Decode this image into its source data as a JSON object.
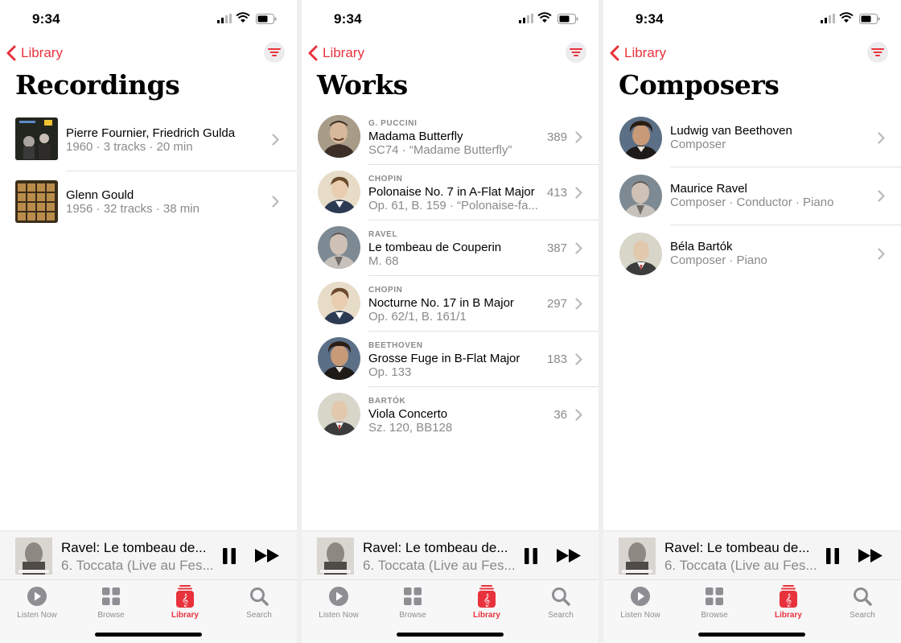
{
  "status": {
    "time": "9:34"
  },
  "nav": {
    "back_label": "Library"
  },
  "screens": {
    "recordings": {
      "title": "Recordings",
      "items": [
        {
          "title": "Pierre Fournier, Friedrich Gulda",
          "subtitle": "1960 · 3 tracks · 20 min"
        },
        {
          "title": "Glenn Gould",
          "subtitle": "1956 · 32 tracks · 38 min"
        }
      ]
    },
    "works": {
      "title": "Works",
      "items": [
        {
          "composer": "G. PUCCINI",
          "title": "Madama Butterfly",
          "subtitle": "SC74 · “Madame Butterfly”",
          "count": "389"
        },
        {
          "composer": "CHOPIN",
          "title": "Polonaise No. 7 in A-Flat Major",
          "subtitle": "Op. 61, B. 159 · “Polonaise-fa...",
          "count": "413"
        },
        {
          "composer": "RAVEL",
          "title": "Le tombeau de Couperin",
          "subtitle": "M. 68",
          "count": "387"
        },
        {
          "composer": "CHOPIN",
          "title": "Nocturne No. 17 in B Major",
          "subtitle": "Op. 62/1, B. 161/1",
          "count": "297"
        },
        {
          "composer": "BEETHOVEN",
          "title": "Grosse Fuge in B-Flat Major",
          "subtitle": "Op. 133",
          "count": "183"
        },
        {
          "composer": "BARTÓK",
          "title": "Viola Concerto",
          "subtitle": "Sz. 120, BB128",
          "count": "36"
        }
      ]
    },
    "composers": {
      "title": "Composers",
      "items": [
        {
          "name": "Ludwig van Beethoven",
          "subtitle": "Composer"
        },
        {
          "name": "Maurice Ravel",
          "subtitle": "Composer · Conductor · Piano"
        },
        {
          "name": "Béla Bartók",
          "subtitle": "Composer · Piano"
        }
      ]
    }
  },
  "player": {
    "title": "Ravel: Le tombeau de...",
    "subtitle": "6. Toccata (Live au Fes..."
  },
  "tabs": [
    {
      "label": "Listen Now",
      "icon": "play-circle-icon"
    },
    {
      "label": "Browse",
      "icon": "grid-icon"
    },
    {
      "label": "Library",
      "icon": "library-icon"
    },
    {
      "label": "Search",
      "icon": "search-icon"
    }
  ],
  "colors": {
    "accent": "#e8323c",
    "secondary_text": "#8a8a8e"
  }
}
